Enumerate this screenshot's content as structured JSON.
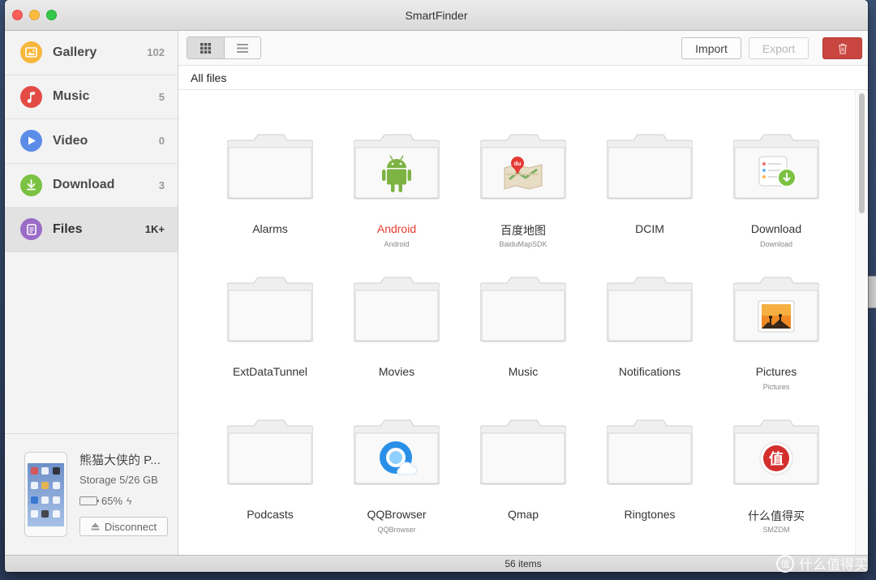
{
  "window": {
    "title": "SmartFinder"
  },
  "sidebar": {
    "items": [
      {
        "label": "Gallery",
        "count": "102",
        "icon": "gallery-icon",
        "color": "#f6b73c"
      },
      {
        "label": "Music",
        "count": "5",
        "icon": "music-icon",
        "color": "#e54b45"
      },
      {
        "label": "Video",
        "count": "0",
        "icon": "video-icon",
        "color": "#5b8de8"
      },
      {
        "label": "Download",
        "count": "3",
        "icon": "download-icon",
        "color": "#7cc242"
      },
      {
        "label": "Files",
        "count": "1K+",
        "icon": "files-icon",
        "color": "#9a6bc7",
        "active": true
      }
    ],
    "device": {
      "name": "熊猫大侠的 P...",
      "storage": "Storage 5/26 GB",
      "battery": "65%",
      "battery_level": 0.65,
      "disconnect_label": "Disconnect"
    }
  },
  "toolbar": {
    "import_label": "Import",
    "export_label": "Export",
    "delete_icon": "trash-icon"
  },
  "breadcrumb": "All files",
  "folders": [
    {
      "name": "Alarms",
      "sub": "",
      "emblem": ""
    },
    {
      "name": "Android",
      "sub": "Android",
      "emblem": "android-icon",
      "highlight": true
    },
    {
      "name": "百度地图",
      "sub": "BaiduMapSDK",
      "emblem": "baidu-map-icon"
    },
    {
      "name": "DCIM",
      "sub": "",
      "emblem": ""
    },
    {
      "name": "Download",
      "sub": "Download",
      "emblem": "download-emblem-icon"
    },
    {
      "name": "ExtDataTunnel",
      "sub": "",
      "emblem": ""
    },
    {
      "name": "Movies",
      "sub": "",
      "emblem": ""
    },
    {
      "name": "Music",
      "sub": "",
      "emblem": ""
    },
    {
      "name": "Notifications",
      "sub": "",
      "emblem": ""
    },
    {
      "name": "Pictures",
      "sub": "Pictures",
      "emblem": "photo-emblem-icon"
    },
    {
      "name": "Podcasts",
      "sub": "",
      "emblem": ""
    },
    {
      "name": "QQBrowser",
      "sub": "QQBrowser",
      "emblem": "qqbrowser-icon"
    },
    {
      "name": "Qmap",
      "sub": "",
      "emblem": ""
    },
    {
      "name": "Ringtones",
      "sub": "",
      "emblem": ""
    },
    {
      "name": "什么值得买",
      "sub": "SMZDM",
      "emblem": "smzdm-icon"
    }
  ],
  "status": {
    "items_text": "56 items"
  },
  "watermark": {
    "text": "什么值得买",
    "badge": "值"
  }
}
